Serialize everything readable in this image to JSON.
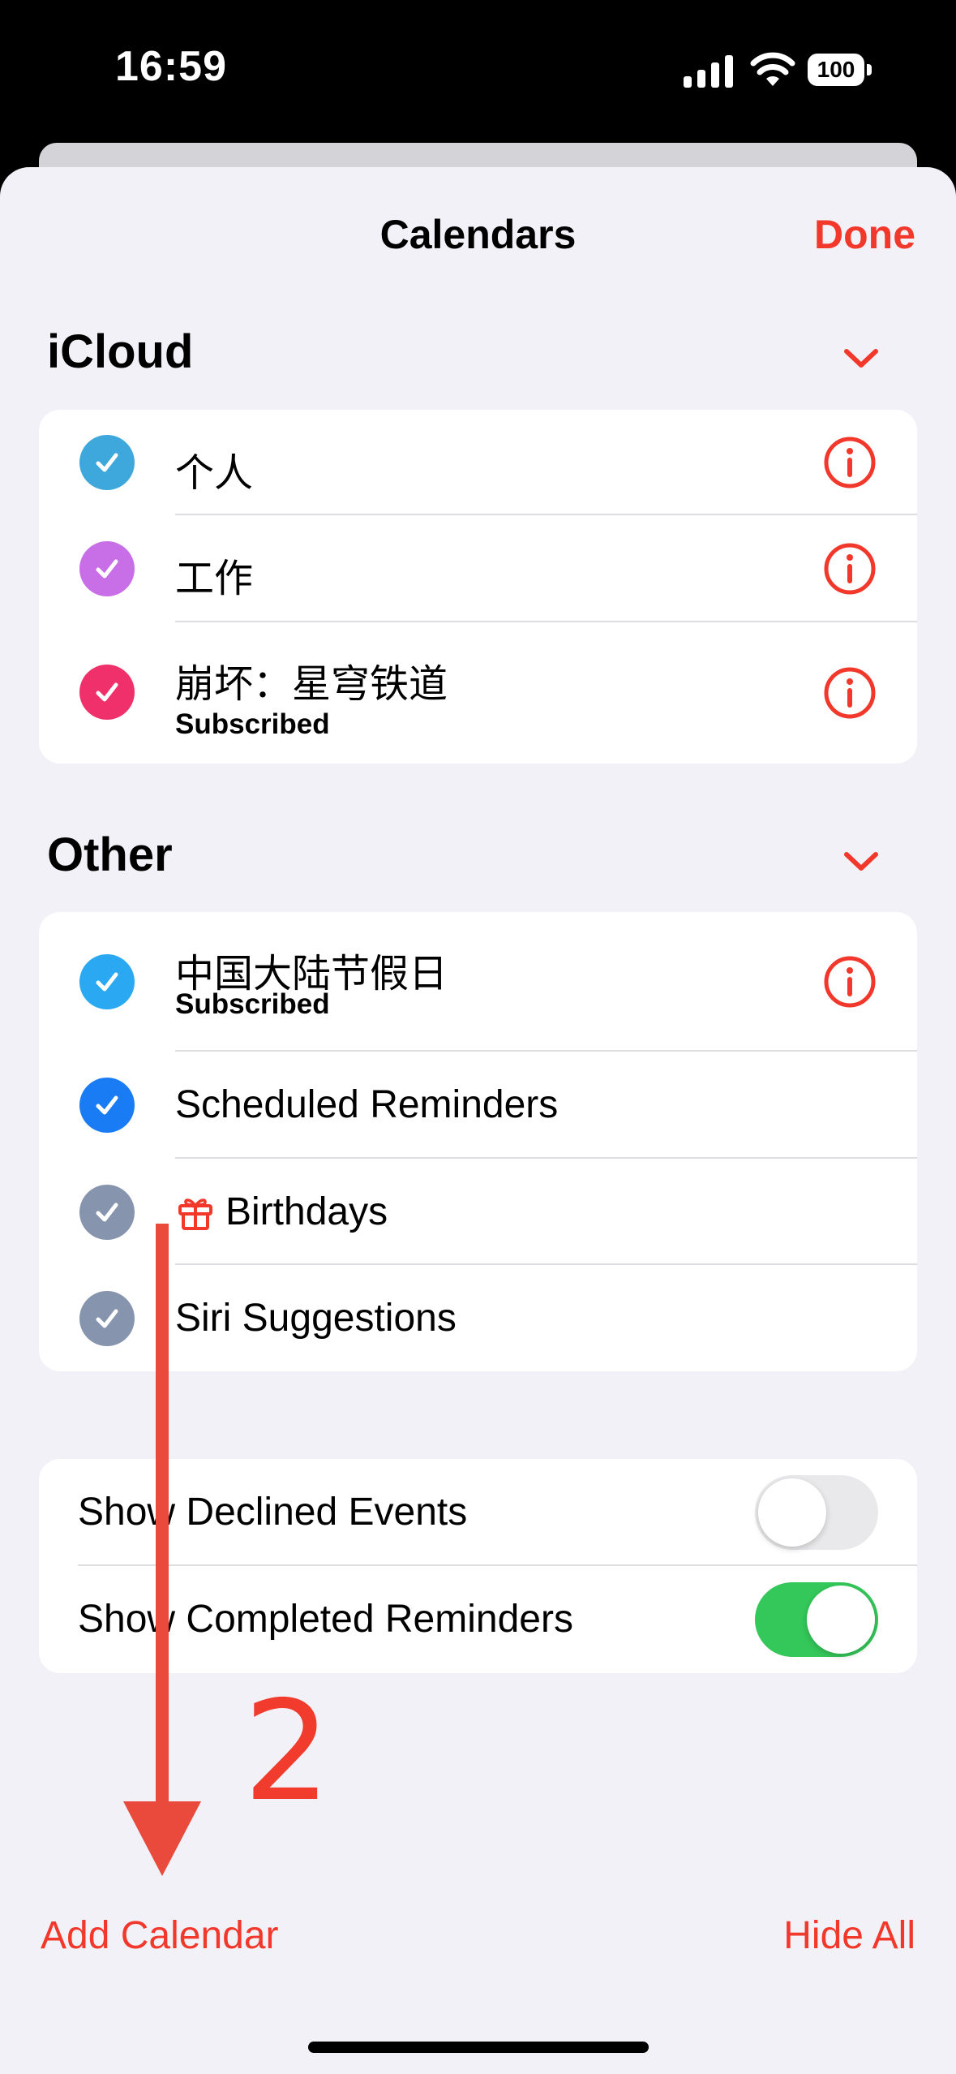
{
  "status_bar": {
    "time": "16:59",
    "battery": "100"
  },
  "nav": {
    "title": "Calendars",
    "done_label": "Done"
  },
  "sections": {
    "icloud": {
      "title": "iCloud",
      "items": [
        {
          "name": "个人",
          "subtitle": "",
          "color": "#3ea8dc"
        },
        {
          "name": "工作",
          "subtitle": "",
          "color": "#c86ee6"
        },
        {
          "name": "崩坏：星穹铁道",
          "subtitle": "Subscribed",
          "color": "#f0306a"
        }
      ]
    },
    "other": {
      "title": "Other",
      "items": [
        {
          "name": "中国大陆节假日",
          "subtitle": "Subscribed",
          "color": "#2aa8f2"
        },
        {
          "name": "Scheduled Reminders",
          "subtitle": "",
          "color": "#1a7cf4"
        },
        {
          "name": "Birthdays",
          "subtitle": "",
          "color": "#8794ad",
          "icon": "gift-icon"
        },
        {
          "name": "Siri Suggestions",
          "subtitle": "",
          "color": "#8794ad"
        }
      ]
    }
  },
  "settings": [
    {
      "label": "Show Declined Events",
      "on": false
    },
    {
      "label": "Show Completed Reminders",
      "on": true
    }
  ],
  "footer": {
    "add_label": "Add Calendar",
    "hide_label": "Hide All"
  },
  "annotation": {
    "number": "2"
  },
  "colors": {
    "accent": "#f2372b",
    "toggle_on": "#34c759",
    "toggle_off": "#e9e9eb",
    "annotation": "#e94a3b"
  }
}
